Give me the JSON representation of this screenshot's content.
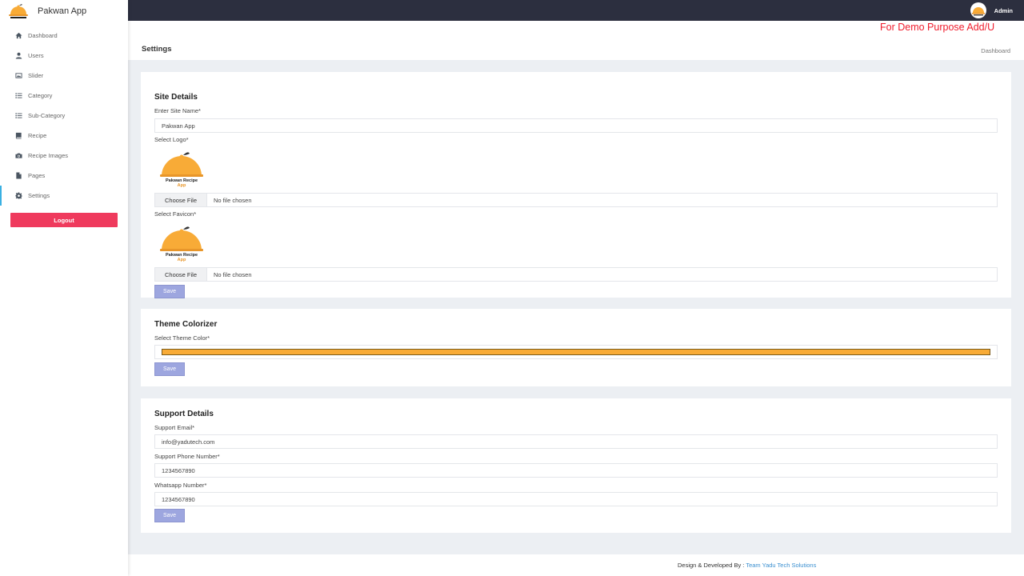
{
  "app": {
    "name": "Pakwan App"
  },
  "sidebar": {
    "items": [
      {
        "label": "Dashboard",
        "icon": "home-icon"
      },
      {
        "label": "Users",
        "icon": "user-icon"
      },
      {
        "label": "Slider",
        "icon": "image-icon"
      },
      {
        "label": "Category",
        "icon": "list-icon"
      },
      {
        "label": "Sub-Category",
        "icon": "list-icon"
      },
      {
        "label": "Recipe",
        "icon": "book-icon"
      },
      {
        "label": "Recipe Images",
        "icon": "camera-icon"
      },
      {
        "label": "Pages",
        "icon": "file-icon"
      },
      {
        "label": "Settings",
        "icon": "gear-icon"
      }
    ],
    "active": "Settings",
    "logout_label": "Logout"
  },
  "topbar": {
    "user_name": "Admin"
  },
  "demo_banner": "For Demo Purpose Add/U",
  "page": {
    "title": "Settings",
    "breadcrumb": "Dashboard"
  },
  "site_details": {
    "title": "Site Details",
    "site_name_label": "Enter Site Name*",
    "site_name_value": "Pakwan App",
    "logo_label": "Select Logo*",
    "favicon_label": "Select Favicon*",
    "logo_text_line1": "Pakwan Recipe",
    "logo_text_line2": "App",
    "choose_file_label": "Choose File",
    "no_file_text": "No file chosen",
    "save_label": "Save"
  },
  "theme": {
    "title": "Theme Colorizer",
    "color_label": "Select Theme Color*",
    "color_value": "#f8ab37",
    "save_label": "Save"
  },
  "support": {
    "title": "Support Details",
    "email_label": "Support Email*",
    "email_value": "info@yadutech.com",
    "phone_label": "Support Phone Number*",
    "phone_value": "1234567890",
    "whatsapp_label": "Whatsapp Number*",
    "whatsapp_value": "1234567890",
    "save_label": "Save"
  },
  "footer": {
    "prefix": "Design & Developed By :",
    "link": "Team Yadu Tech Solutions"
  },
  "colors": {
    "accent": "#f8ab37",
    "logout": "#ef3a5d",
    "topbar": "#2c2f3f",
    "banner": "#f01c2c",
    "save_button": "#9da6df"
  }
}
